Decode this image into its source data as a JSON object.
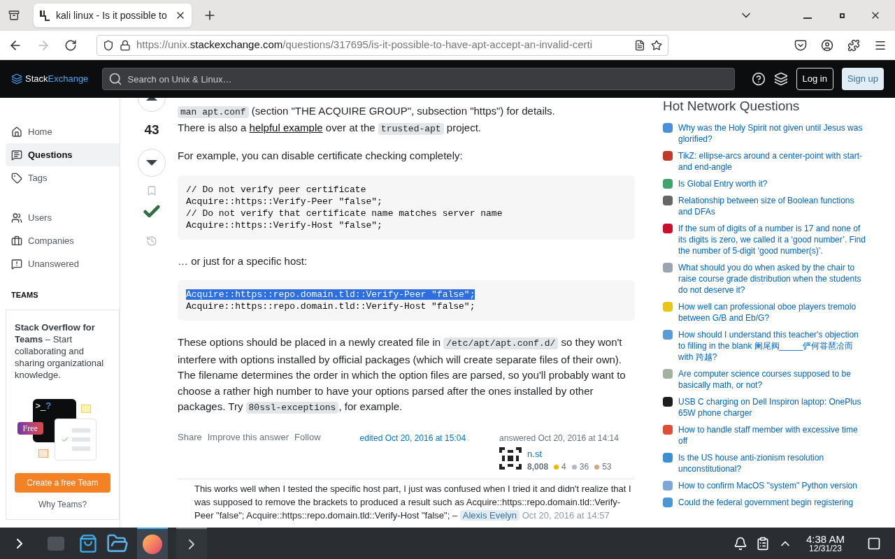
{
  "browser": {
    "tab_title": "kali linux - Is it possible to",
    "url_scheme": "https://unix.",
    "url_domain": "stackexchange.com",
    "url_path": "/questions/317695/is-it-possible-to-have-apt-accept-an-invalid-certi"
  },
  "header": {
    "logo_a": "Stack",
    "logo_b": "Exchange",
    "search_placeholder": "Search on Unix & Linux…",
    "login": "Log in",
    "signup": "Sign up"
  },
  "nav": [
    {
      "label": "Home",
      "kind": "home",
      "selected": false
    },
    {
      "label": "Questions",
      "kind": "questions",
      "selected": true
    },
    {
      "label": "Tags",
      "kind": "tags",
      "selected": false
    },
    {
      "label": "Users",
      "kind": "users",
      "selected": false
    },
    {
      "label": "Companies",
      "kind": "companies",
      "selected": false
    },
    {
      "label": "Unanswered",
      "kind": "unanswered",
      "selected": false
    }
  ],
  "teams": {
    "heading": "TEAMS",
    "text": "**Stack Overflow for Teams** – Start collaborating and sharing organizational knowledge.",
    "prompt": ">_",
    "qmark": "?",
    "badge": "Free",
    "button": "Create a free Team",
    "link": "Why Teams?"
  },
  "answer": {
    "score": "43",
    "accepted": true,
    "intro": [
      [
        {
          "kind": "code",
          "text": "man apt.conf"
        },
        {
          "kind": "text",
          "text": " (section \"THE ACQUIRE GROUP\", subsection \"https\") for details."
        }
      ],
      [
        {
          "kind": "text",
          "text": "There is also a "
        },
        {
          "kind": "link",
          "text": "helpful example"
        },
        {
          "kind": "text",
          "text": " over at the "
        },
        {
          "kind": "code",
          "text": "trusted-apt"
        },
        {
          "kind": "text",
          "text": " project."
        }
      ]
    ],
    "p1": "For example, you can disable certificate checking completely:",
    "code1": [
      {
        "text": "// Do not verify peer certificate",
        "selected": false
      },
      {
        "text": "Acquire::https::Verify-Peer \"false\";",
        "selected": false
      },
      {
        "text": "// Do not verify that certificate name matches server name",
        "selected": false
      },
      {
        "text": "Acquire::https::Verify-Host \"false\";",
        "selected": false
      }
    ],
    "p2": "… or just for a specific host:",
    "code2": [
      {
        "text": "Acquire::https::repo.domain.tld::Verify-Peer \"false\";",
        "selected": true
      },
      {
        "text": "Acquire::https::repo.domain.tld::Verify-Host \"false\";",
        "selected": false
      }
    ],
    "p3": [
      {
        "kind": "text",
        "text": "These options should be placed in a newly created file in "
      },
      {
        "kind": "code",
        "text": "/etc/apt/apt.conf.d/"
      },
      {
        "kind": "text",
        "text": " so they won't interfere with options installed by official packages (which will create separate files of their own). The filename determines the order in which the option files are parsed, so you'll probably want to choose a rather high number to have your options parsed after the ones installed by other packages. Try "
      },
      {
        "kind": "code",
        "text": "80ssl-exceptions"
      },
      {
        "kind": "text",
        "text": ", for example."
      }
    ],
    "actions": [
      "Share",
      "Improve this answer",
      "Follow"
    ],
    "edited": "edited Oct 20, 2016 at 15:04",
    "answered": "answered Oct 20, 2016 at 14:14",
    "user": {
      "name": "n.st",
      "rep": "8,008",
      "badges": [
        {
          "count": "4",
          "color": "#f1b600"
        },
        {
          "count": "36",
          "color": "#b4b8bc"
        },
        {
          "count": "53",
          "color": "#d1a684"
        }
      ]
    }
  },
  "comment": {
    "text": "This works well when I tested the specific host part, I just was confused when I tried it and didn't realize that I was supposed to remove the brackets to produced a result such as Acquire::https::repo.domain.tld::Verify-Peer \"false\"; Acquire::https::repo.domain.tld::Verify-Host \"false\"; –",
    "author": "Alexis Evelyn",
    "time": "Oct 20, 2016 at 14:57"
  },
  "hot": {
    "title": "Hot Network Questions",
    "items": [
      {
        "text": "Why was the Holy Spirit not given until Jesus was glorified?",
        "color": "#4a90d9"
      },
      {
        "text": "TikZ: ellipse-arcs around a center-point with start- and end-angle",
        "color": "#c0392b"
      },
      {
        "text": "Is Global Entry worth it?",
        "color": "#3fa36b"
      },
      {
        "text": "Relationship between size of Boolean functions and DFAs",
        "color": "#666666"
      },
      {
        "text": "If the sum of digits of a number is 17 and none of its digits is zero, we called it a ‘good number’. Find the number of 5-digit ‘good number(s)’.",
        "color": "#c8102e"
      },
      {
        "text": "What should you do when asked by the chair to raise course grade distribution when the students do not deserve it?",
        "color": "#9aa5b1"
      },
      {
        "text": "How well can professional oboe players tremolo between G/B and Eb/G?",
        "color": "#e8c619"
      },
      {
        "text": "How should I understand this teacher's objection to filling in the blank 阑尾阀_____俨何甞琶冾而 with 跨越?",
        "color": "#5b9bd5"
      },
      {
        "text": "Are computer science courses supposed to be basically math, or not?",
        "color": "#a3b1a0"
      },
      {
        "text": "USB C charging on Dell Inspiron laptop: OnePlus 65W phone charger",
        "color": "#1d1d1d"
      },
      {
        "text": "How to handle staff member with excessive time off",
        "color": "#e04e39"
      },
      {
        "text": "Is the US house anti-zionism resolution unconstitutional?",
        "color": "#3d8fd1"
      },
      {
        "text": "How to confirm MacOS \"system\" Python version",
        "color": "#7ea6d6"
      },
      {
        "text": "Could the federal government begin registering",
        "color": "#4b97d4"
      }
    ]
  },
  "taskbar": {
    "time": "4:38 AM",
    "date": "12/31/23"
  }
}
